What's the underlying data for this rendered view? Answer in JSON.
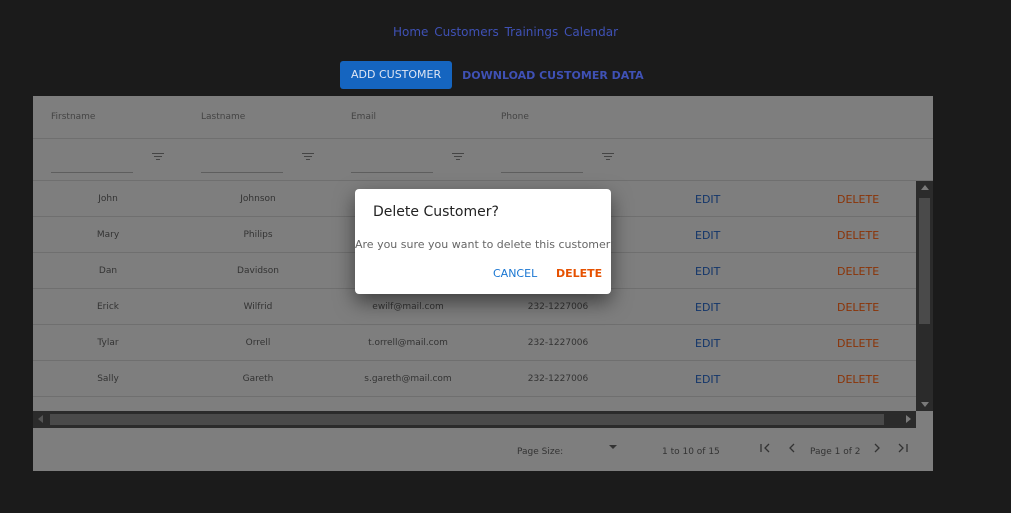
{
  "nav": {
    "items": [
      "Home",
      "Customers",
      "Trainings",
      "Calendar"
    ]
  },
  "toolbar": {
    "add_label": "ADD CUSTOMER",
    "download_label": "DOWNLOAD CUSTOMER DATA"
  },
  "grid": {
    "columns": [
      "Firstname",
      "Lastname",
      "Email",
      "Phone"
    ],
    "rows": [
      {
        "first": "John",
        "last": "Johnson",
        "email": "",
        "phone": "",
        "edit": "EDIT",
        "delete": "DELETE"
      },
      {
        "first": "Mary",
        "last": "Philips",
        "email": "",
        "phone": "",
        "edit": "EDIT",
        "delete": "DELETE"
      },
      {
        "first": "Dan",
        "last": "Davidson",
        "email": "",
        "phone": "",
        "edit": "EDIT",
        "delete": "DELETE"
      },
      {
        "first": "Erick",
        "last": "Wilfrid",
        "email": "ewilf@mail.com",
        "phone": "232-1227006",
        "edit": "EDIT",
        "delete": "DELETE"
      },
      {
        "first": "Tylar",
        "last": "Orrell",
        "email": "t.orrell@mail.com",
        "phone": "232-1227006",
        "edit": "EDIT",
        "delete": "DELETE"
      },
      {
        "first": "Sally",
        "last": "Gareth",
        "email": "s.gareth@mail.com",
        "phone": "232-1227006",
        "edit": "EDIT",
        "delete": "DELETE"
      }
    ]
  },
  "pagination": {
    "page_size_label": "Page Size:",
    "range_text": "1 to 10 of 15",
    "page_text": "Page 1 of 2"
  },
  "dialog": {
    "title": "Delete Customer?",
    "message": "Are you sure you want to delete this customer?",
    "cancel_label": "CANCEL",
    "delete_label": "DELETE"
  },
  "colors": {
    "background": "#1b1b1b",
    "accent": "#1565c0",
    "link": "#3f51b5",
    "delete": "#e65100",
    "cancel": "#1976d2"
  },
  "icons": [
    "filter-icon",
    "first-page-icon",
    "prev-page-icon",
    "next-page-icon",
    "last-page-icon",
    "dropdown-arrow-icon"
  ]
}
